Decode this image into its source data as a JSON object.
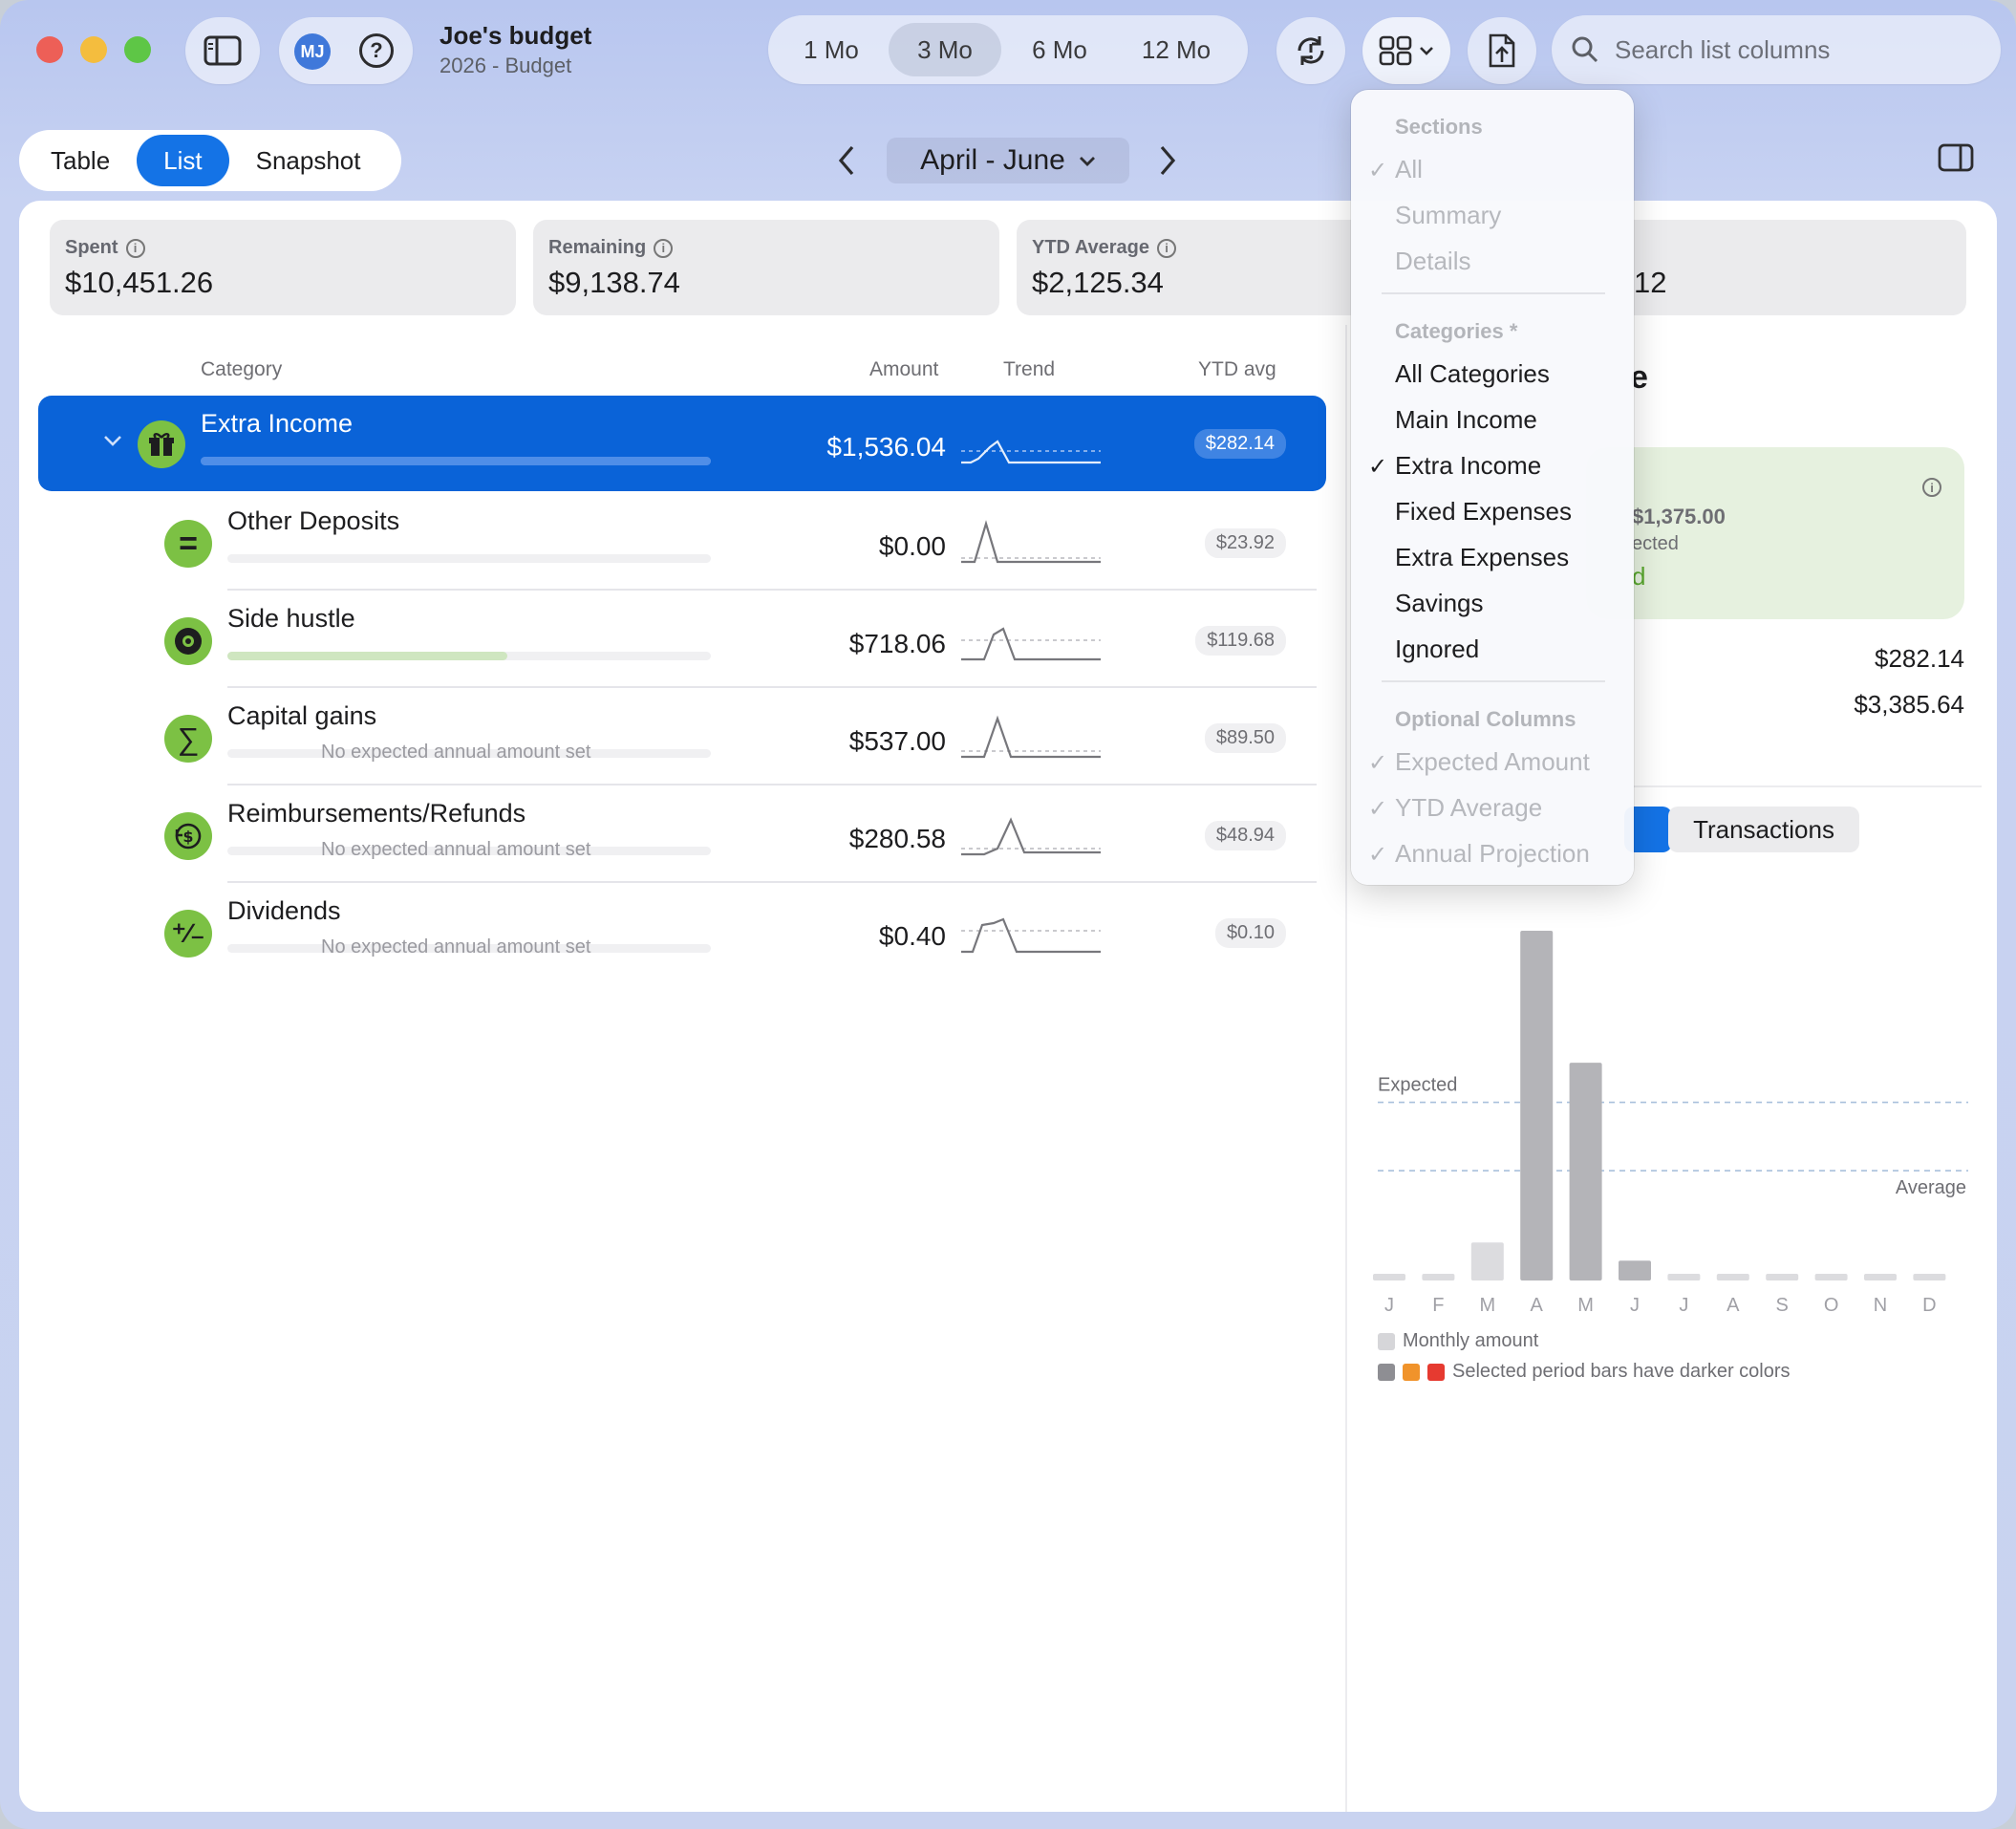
{
  "window": {
    "title": "Joe's budget",
    "subtitle": "2026 - Budget",
    "avatar": "MJ"
  },
  "toolbar": {
    "periods": [
      "1 Mo",
      "3 Mo",
      "6 Mo",
      "12 Mo"
    ],
    "selected_period": "3 Mo",
    "search_placeholder": "Search list columns"
  },
  "view_tabs": [
    "Table",
    "List",
    "Snapshot"
  ],
  "selected_view": "List",
  "period_picker": {
    "label": "April - June"
  },
  "summary_cards": [
    {
      "label": "Spent",
      "value": "$10,451.26"
    },
    {
      "label": "Remaining",
      "value": "$9,138.74"
    },
    {
      "label": "YTD Average",
      "value": "$2,125.34"
    },
    {
      "label": "",
      "value": "12"
    }
  ],
  "columns": {
    "category": "Category",
    "amount": "Amount",
    "trend": "Trend",
    "ytd": "YTD avg"
  },
  "rows": [
    {
      "name": "Extra Income",
      "amount": "$1,536.04",
      "ytd": "$282.14",
      "progress": 1.0
    },
    {
      "name": "Other Deposits",
      "amount": "$0.00",
      "ytd": "$23.92",
      "progress": 0.0
    },
    {
      "name": "Side hustle",
      "amount": "$718.06",
      "ytd": "$119.68",
      "progress": 0.58
    },
    {
      "name": "Capital gains",
      "amount": "$537.00",
      "ytd": "$89.50",
      "note": "No expected annual amount set"
    },
    {
      "name": "Reimbursements/Refunds",
      "amount": "$280.58",
      "ytd": "$48.94",
      "note": "No expected annual amount set"
    },
    {
      "name": "Dividends",
      "amount": "$0.40",
      "ytd": "$0.10",
      "note": "No expected annual amount set"
    }
  ],
  "detail": {
    "title_fragment": "e",
    "expected_amount": "$1,375.00",
    "expected_label": "ected",
    "status_fragment": "d",
    "ytd_avg_value": "$282.14",
    "projection_value": "$3,385.64",
    "transactions_tab": "Transactions"
  },
  "menu": {
    "sections_header": "Sections",
    "sections": [
      {
        "label": "All",
        "checked": true
      },
      {
        "label": "Summary",
        "checked": false
      },
      {
        "label": "Details",
        "checked": false
      }
    ],
    "categories_header": "Categories *",
    "categories": [
      {
        "label": "All Categories",
        "checked": false
      },
      {
        "label": "Main Income",
        "checked": false
      },
      {
        "label": "Extra Income",
        "checked": true
      },
      {
        "label": "Fixed Expenses",
        "checked": false
      },
      {
        "label": "Extra Expenses",
        "checked": false
      },
      {
        "label": "Savings",
        "checked": false
      },
      {
        "label": "Ignored",
        "checked": false
      }
    ],
    "optional_header": "Optional Columns",
    "optional": [
      {
        "label": "Expected Amount",
        "checked": true
      },
      {
        "label": "YTD Average",
        "checked": true
      },
      {
        "label": "Annual Projection",
        "checked": true
      }
    ]
  },
  "chart_data": {
    "type": "bar",
    "categories": [
      "J",
      "F",
      "M",
      "A",
      "M",
      "J",
      "J",
      "A",
      "S",
      "O",
      "N",
      "D"
    ],
    "values": [
      0,
      0,
      115,
      1060,
      660,
      60,
      0,
      0,
      0,
      0,
      0,
      0
    ],
    "selected_months": [
      3,
      4,
      5
    ],
    "reference_lines": [
      {
        "label": "Expected",
        "value": 540
      },
      {
        "label": "Average",
        "value": 333
      }
    ],
    "legend": [
      "Monthly amount",
      "Selected period bars have darker colors"
    ],
    "colors": {
      "bar": "#dcdcdf",
      "selected": "#b4b4b8",
      "swatch_orange": "#f0932b",
      "swatch_red": "#e63a30"
    }
  },
  "colors": {
    "accent": "#1473e6",
    "icon_green": "#7cc144"
  }
}
